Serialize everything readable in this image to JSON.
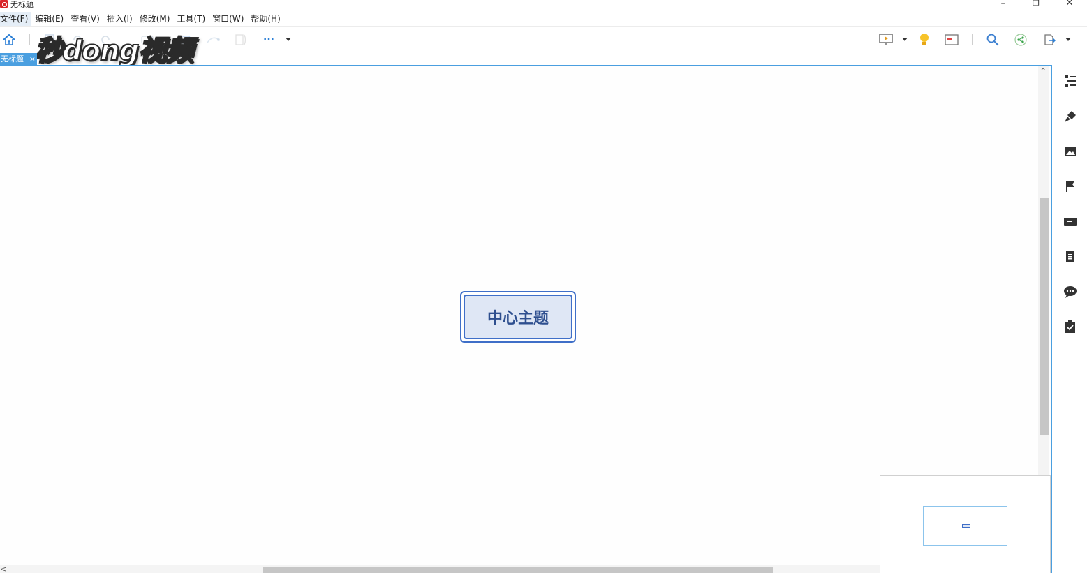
{
  "window": {
    "title": "无标题",
    "minimize": "–",
    "restore": "❐",
    "close": "✕"
  },
  "menu": [
    {
      "label": "文件(F)"
    },
    {
      "label": "编辑(E)"
    },
    {
      "label": "查看(V)"
    },
    {
      "label": "插入(I)"
    },
    {
      "label": "修改(M)"
    },
    {
      "label": "工具(T)"
    },
    {
      "label": "窗口(W)"
    },
    {
      "label": "帮助(H)"
    }
  ],
  "toolbar": {
    "left_icons": [
      "home-icon",
      "new-icon",
      "undo-icon",
      "redo-icon",
      "subtopic-icon",
      "topic-icon",
      "relationship-icon",
      "summary-icon",
      "more-icon"
    ],
    "more_label": "···",
    "right_icons": [
      "presentation-icon",
      "brainstorm-icon",
      "gantt-icon",
      "search-icon",
      "share-icon",
      "export-icon"
    ]
  },
  "watermark": {
    "text": "秒dong视频"
  },
  "tabs": [
    {
      "label": "无标题",
      "close": "×"
    }
  ],
  "canvas": {
    "central_topic": "中心主题",
    "scroll_up": "^",
    "scroll_left": "<"
  },
  "sidebar": {
    "icons": [
      "outline-icon",
      "format-icon",
      "image-icon",
      "marker-icon",
      "label-icon",
      "notes-icon",
      "comments-icon",
      "task-icon"
    ]
  },
  "colors": {
    "accent": "#4a9fe0",
    "topic_border": "#3f6fc8",
    "topic_fill": "#dfe7f5",
    "topic_text": "#2e4f8f"
  }
}
